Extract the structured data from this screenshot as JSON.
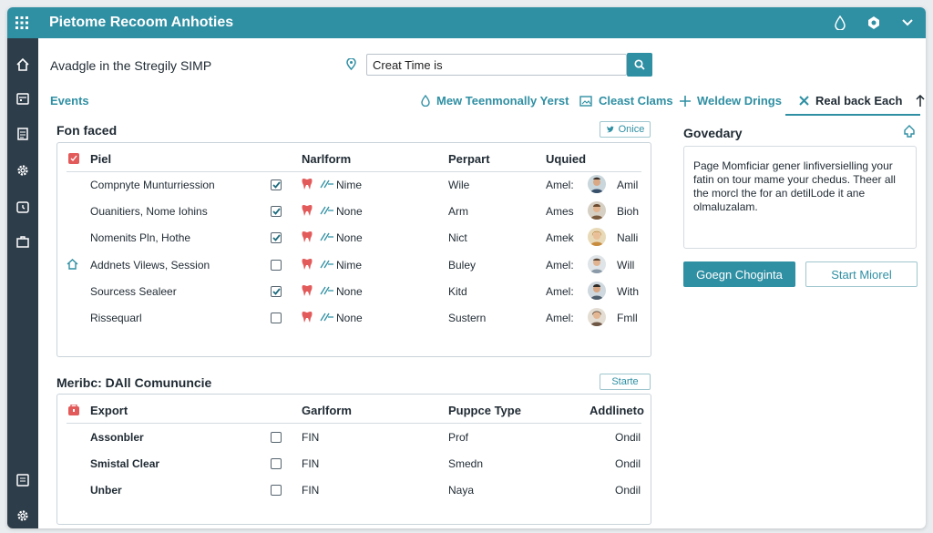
{
  "app": {
    "title": "Pietome Recoom Anhoties"
  },
  "header": {
    "subtitle": "Avadgle in the Stregily SIMP",
    "search_value": "Creat Time is"
  },
  "tabs": {
    "events_label": "Events",
    "items": [
      {
        "label": "Mew Teenmonally Yerst",
        "icon": "drop-icon"
      },
      {
        "label": "Cleast Clams",
        "icon": "image-icon"
      },
      {
        "label": "Weldew Drings",
        "icon": "plus-icon"
      },
      {
        "label": "Real back Each",
        "icon": "close-icon"
      }
    ]
  },
  "section1": {
    "title": "Fon faced",
    "action_label": "Onice",
    "columns": [
      "Piel",
      "Narlform",
      "Perpart",
      "Uquied"
    ],
    "rows": [
      {
        "name": "Compnyte Munturriession",
        "checked": true,
        "platform": "Nime",
        "part": "Wile",
        "status": "Amel:",
        "user": "Amil"
      },
      {
        "name": "Ouanitiers, Nome Iohins",
        "checked": true,
        "platform": "None",
        "part": "Arm",
        "status": "Ames",
        "user": "Bioh"
      },
      {
        "name": "Nomenits Pln, Hothe",
        "checked": true,
        "platform": "None",
        "part": "Nict",
        "status": "Amek",
        "user": "Nalli"
      },
      {
        "name": "Addnets Vilews, Session",
        "checked": false,
        "platform": "Nime",
        "part": "Buley",
        "status": "Amel:",
        "user": "Will"
      },
      {
        "name": "Sourcess Sealeer",
        "checked": true,
        "platform": "None",
        "part": "Kitd",
        "status": "Amel:",
        "user": "With"
      },
      {
        "name": "Rissequarl",
        "checked": false,
        "platform": "None",
        "part": "Sustern",
        "status": "Amel:",
        "user": "Fmll"
      }
    ]
  },
  "section2": {
    "title": "Meribc: DAll Comununcie",
    "action_label": "Starte",
    "columns": [
      "Export",
      "Garlform",
      "Puppce Type",
      "Addlineto"
    ],
    "rows": [
      {
        "name": "Assonbler",
        "checked": false,
        "form": "FIN",
        "type": "Prof",
        "addl": "Ondil"
      },
      {
        "name": "Smistal Clear",
        "checked": false,
        "form": "FIN",
        "type": "Smedn",
        "addl": "Ondil"
      },
      {
        "name": "Unber",
        "checked": false,
        "form": "FIN",
        "type": "Naya",
        "addl": "Ondil"
      }
    ]
  },
  "right_panel": {
    "title": "Govedary",
    "text": "Page Momficiar gener linfiversielling your fatin on tour mame your chedus. Theer all the morcl the for an detilLode it ane olmaluzalam.",
    "primary_label": "Goegn Choginta",
    "secondary_label": "Start Miorel"
  },
  "colors": {
    "accent": "#2f8fa3",
    "sidebar": "#2e3d4a",
    "danger": "#e35a5a"
  }
}
